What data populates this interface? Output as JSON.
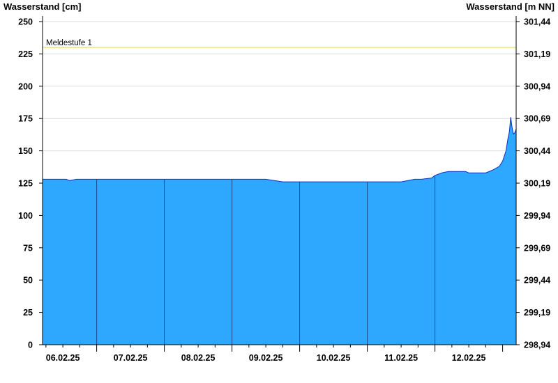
{
  "chart_data": {
    "type": "area",
    "title_left": "Wasserstand [cm]",
    "title_right": "Wasserstand [m NN]",
    "ylim": [
      0,
      250
    ],
    "y_ticks": [
      0,
      25,
      50,
      75,
      100,
      125,
      150,
      175,
      200,
      225,
      250
    ],
    "y2_ticks": [
      "298,94",
      "299,19",
      "299,44",
      "299,69",
      "299,94",
      "300,19",
      "300,44",
      "300,69",
      "300,94",
      "301,19",
      "301,44"
    ],
    "x_labels": [
      "06.02.25",
      "07.02.25",
      "08.02.25",
      "09.02.25",
      "10.02.25",
      "11.02.25",
      "12.02.25"
    ],
    "x_range_days": [
      -0.3,
      6.7
    ],
    "threshold": {
      "label": "Meldestufe 1",
      "value": 230,
      "color": "#e8d44a"
    },
    "series": [
      {
        "fill": "#2ea8ff",
        "stroke": "#1030c0",
        "x": [
          -0.3,
          0.05,
          0.1,
          0.2,
          0.5,
          1.0,
          2.0,
          3.0,
          3.25,
          3.5,
          3.75,
          4.0,
          4.25,
          4.5,
          4.75,
          5.0,
          5.1,
          5.2,
          5.3,
          5.45,
          5.5,
          5.6,
          5.7,
          5.95,
          6.0,
          6.25,
          6.35,
          6.45,
          6.5,
          6.55,
          6.58,
          6.6,
          6.62,
          6.64,
          6.66,
          6.68,
          6.7
        ],
        "y": [
          128,
          128,
          127,
          128,
          128,
          128,
          128,
          128,
          126,
          126,
          126,
          126,
          126,
          126,
          126,
          126,
          127,
          128,
          128,
          129,
          131,
          133,
          134,
          134,
          133,
          133,
          135,
          138,
          142,
          150,
          160,
          165,
          176,
          168,
          163,
          164,
          167
        ]
      }
    ]
  }
}
